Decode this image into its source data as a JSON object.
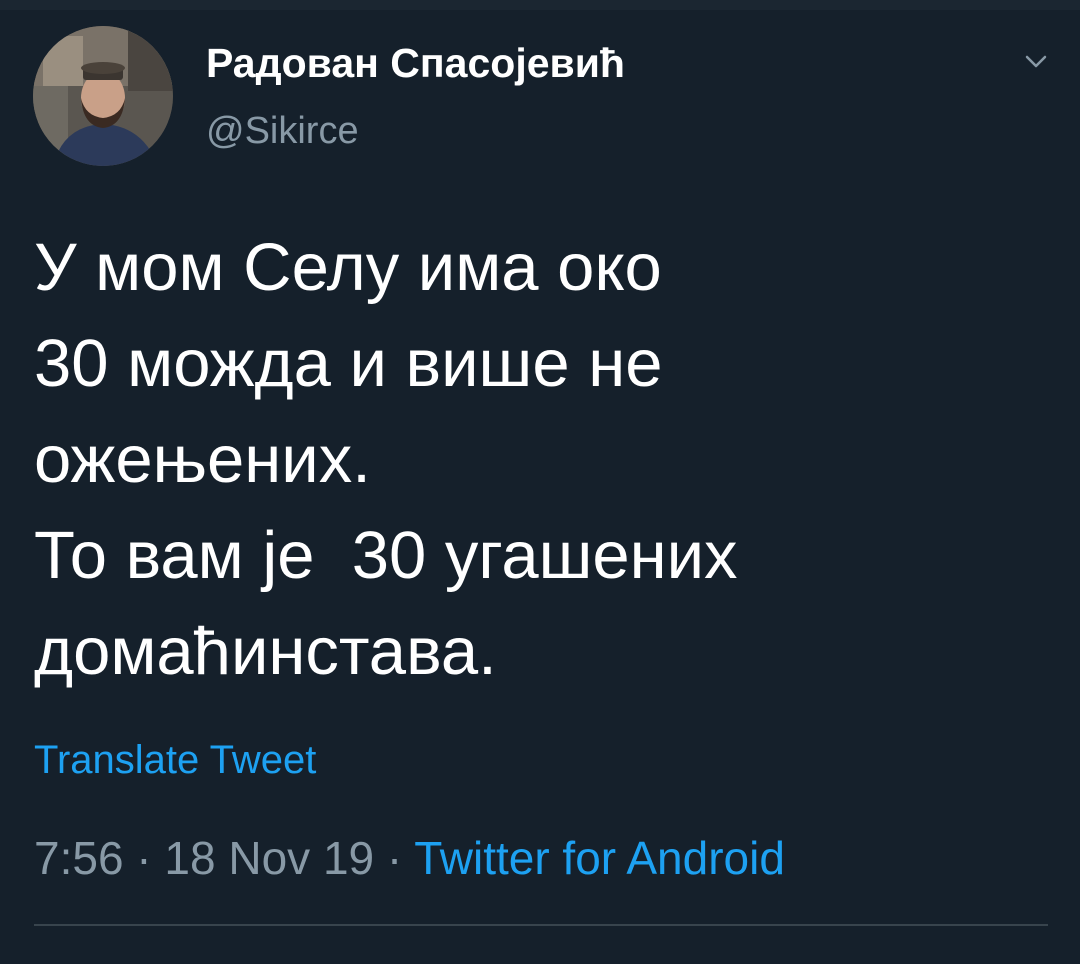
{
  "tweet": {
    "author": {
      "display_name": "Радован Спасојевић",
      "handle": "@Sikirce"
    },
    "menu_icon": "chevron-down-icon",
    "text_lines": [
      "У мом Селу има око",
      "30 можда и више не",
      "ожењених.",
      "То вам је  30 угашених",
      "домаћинстава."
    ],
    "translate_label": "Translate Tweet",
    "meta": {
      "time": "7:56",
      "separator": " · ",
      "date": "18 Nov 19",
      "source": "Twitter for Android"
    }
  },
  "colors": {
    "background": "#15202b",
    "text": "#ffffff",
    "muted": "#8899a6",
    "link": "#1da1f2",
    "divider": "#38444d"
  }
}
